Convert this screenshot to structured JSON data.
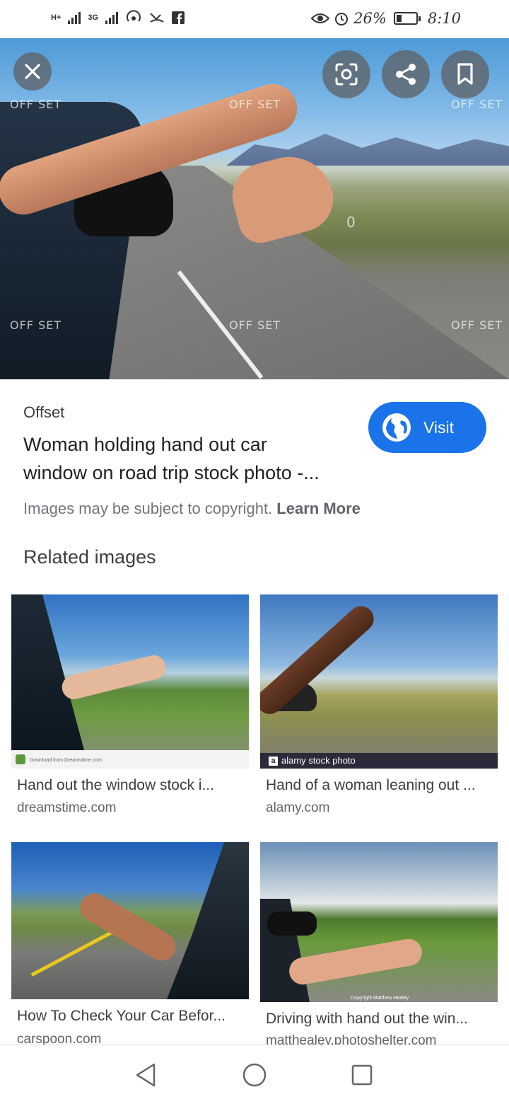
{
  "status_bar": {
    "network_1": "H+",
    "network_2": "3G",
    "battery_text": "26%",
    "battery_level": 0.26,
    "time": "8:10"
  },
  "hero": {
    "watermark": "OFF SET",
    "watermark_center": "0",
    "actions": {
      "close": "close-icon",
      "lens": "lens-icon",
      "share": "share-icon",
      "save": "bookmark-icon"
    }
  },
  "info": {
    "source": "Offset",
    "title_line1": "Woman holding hand out car",
    "title_line2": "window on road trip stock photo -...",
    "visit_label": "Visit",
    "copyright_text": "Images may be subject to copyright.",
    "learn_more": "Learn More"
  },
  "related": {
    "heading": "Related images",
    "items": [
      {
        "title": "Hand out the window stock i...",
        "source": "dreamstime.com",
        "overlay": "Download from Dreamstime.com"
      },
      {
        "title": "Hand of a woman leaning out ...",
        "source": "alamy.com",
        "overlay": "alamy stock photo"
      },
      {
        "title": "How To Check Your Car Befor...",
        "source": "carspoon.com",
        "overlay": ""
      },
      {
        "title": "Driving with hand out the win...",
        "source": "matthealey.photoshelter.com",
        "overlay": "Copyright Matthew Healey"
      }
    ]
  },
  "colors": {
    "accent": "#1a73e8",
    "hero_button": "#5f6368"
  }
}
